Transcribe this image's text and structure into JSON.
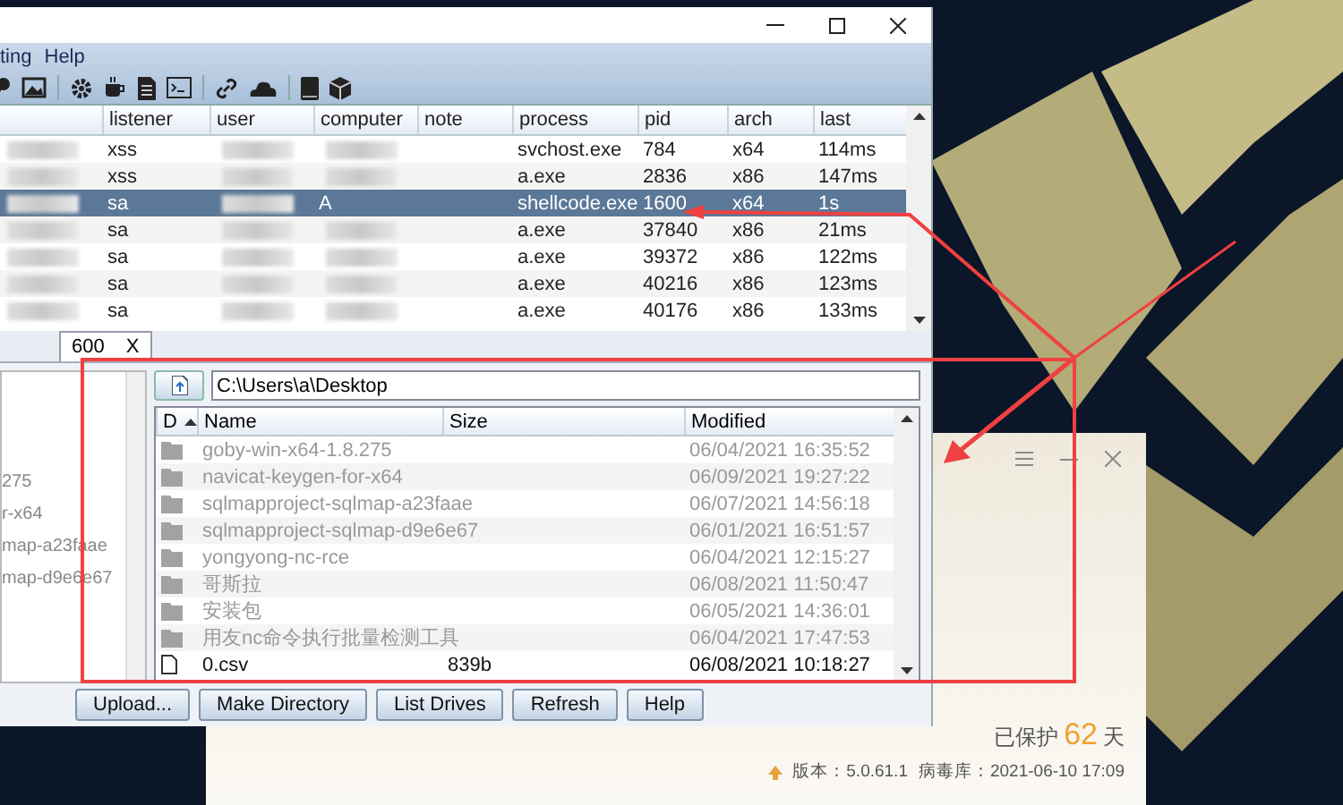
{
  "menu": [
    "ting",
    "Help"
  ],
  "table": {
    "columns": [
      "listener",
      "user",
      "computer",
      "note",
      "process",
      "pid",
      "arch",
      "last"
    ],
    "rows": [
      {
        "selected": false,
        "listener": "xss",
        "process": "svchost.exe",
        "pid": "784",
        "arch": "x64",
        "last": "114ms"
      },
      {
        "selected": false,
        "listener": "xss",
        "process": "a.exe",
        "pid": "2836",
        "arch": "x86",
        "last": "147ms"
      },
      {
        "selected": true,
        "listener": "sa",
        "computer": "A",
        "process": "shellcode.exe",
        "pid": "1600",
        "arch": "x64",
        "last": "1s"
      },
      {
        "selected": false,
        "listener": "sa",
        "process": "a.exe",
        "pid": "37840",
        "arch": "x86",
        "last": "21ms"
      },
      {
        "selected": false,
        "listener": "sa",
        "process": "a.exe",
        "pid": "39372",
        "arch": "x86",
        "last": "122ms"
      },
      {
        "selected": false,
        "listener": "sa",
        "process": "a.exe",
        "pid": "40216",
        "arch": "x86",
        "last": "123ms"
      },
      {
        "selected": false,
        "listener": "sa",
        "process": "a.exe",
        "pid": "40176",
        "arch": "x86",
        "last": "133ms"
      }
    ]
  },
  "tab": {
    "label": "600",
    "close": "X"
  },
  "tree": [
    "275",
    "r-x64",
    "map-a23faae",
    "map-d9e6e67"
  ],
  "files": {
    "path": "C:\\Users\\a\\Desktop",
    "columns": [
      "D",
      "Name",
      "Size",
      "Modified"
    ],
    "rows": [
      {
        "kind": "folder",
        "name": "goby-win-x64-1.8.275",
        "modified": "06/04/2021 16:35:52"
      },
      {
        "kind": "folder",
        "name": "navicat-keygen-for-x64",
        "modified": "06/09/2021 19:27:22"
      },
      {
        "kind": "folder",
        "name": "sqlmapproject-sqlmap-a23faae",
        "modified": "06/07/2021 14:56:18"
      },
      {
        "kind": "folder",
        "name": "sqlmapproject-sqlmap-d9e6e67",
        "modified": "06/01/2021 16:51:57"
      },
      {
        "kind": "folder",
        "name": "yongyong-nc-rce",
        "modified": "06/04/2021 12:15:27"
      },
      {
        "kind": "folder",
        "name": "哥斯拉",
        "modified": "06/08/2021 11:50:47"
      },
      {
        "kind": "folder",
        "name": "安装包",
        "modified": "06/05/2021 14:36:01"
      },
      {
        "kind": "folder",
        "name": "用友nc命令执行批量检测工具",
        "modified": "06/04/2021 17:47:53"
      },
      {
        "kind": "file",
        "name": "0.csv",
        "size": "839b",
        "modified": "06/08/2021 10:18:27"
      }
    ]
  },
  "buttons": [
    "Upload...",
    "Make Directory",
    "List Drives",
    "Refresh",
    "Help"
  ],
  "av": {
    "protected": "已保护",
    "days": "62",
    "unit": "天",
    "version": "版本：5.0.61.1",
    "db": "病毒库：2021-06-10 17:09"
  }
}
